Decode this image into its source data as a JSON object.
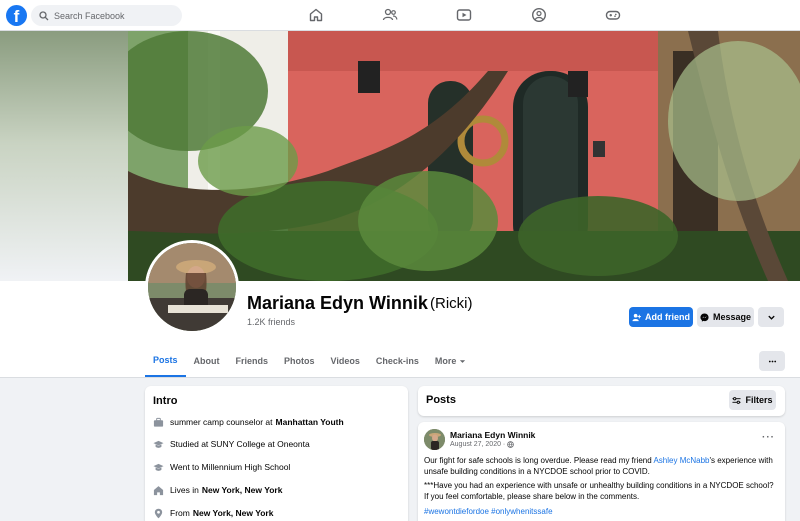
{
  "topbar": {
    "logo": "f",
    "search_placeholder": "Search Facebook",
    "nav_icons": [
      "home-icon",
      "friends-icon",
      "watch-icon",
      "groups-icon",
      "gaming-icon"
    ]
  },
  "profile": {
    "name": "Mariana Edyn Winnik",
    "nickname": "(Ricki)",
    "friends_count": "1.2K friends",
    "add_friend_label": "Add friend",
    "message_label": "Message"
  },
  "tabs": [
    {
      "label": "Posts",
      "active": true
    },
    {
      "label": "About"
    },
    {
      "label": "Friends"
    },
    {
      "label": "Photos"
    },
    {
      "label": "Videos"
    },
    {
      "label": "Check-ins"
    },
    {
      "label": "More"
    }
  ],
  "intro": {
    "title": "Intro",
    "items": [
      {
        "text": "summer camp counselor at",
        "bold": "Manhattan Youth",
        "icon": "briefcase-icon"
      },
      {
        "text": "Studied at SUNY College at Oneonta",
        "bold": "",
        "icon": "graduation-cap-icon"
      },
      {
        "text": "Went to Millennium High School",
        "bold": "",
        "icon": "graduation-cap-icon"
      },
      {
        "text": "Lives in",
        "bold": "New York, New York",
        "icon": "home-icon"
      },
      {
        "text": "From",
        "bold": "New York, New York",
        "icon": "location-pin-icon"
      }
    ]
  },
  "posts": {
    "title": "Posts",
    "filters_label": "Filters",
    "post": {
      "author": "Mariana Edyn Winnik",
      "date": "August 27, 2020 ·",
      "para1_a": "Our fight for safe schools is long overdue. Please read my friend ",
      "para1_link": "Ashley McNabb",
      "para1_b": "'s experience with unsafe building conditions in a NYCDOE school prior to COVID.",
      "para2": "***Have you had an experience with unsafe or unhealthy building conditions in a NYCDOE school? If you feel comfortable, please share below in the comments.",
      "hashtags": "#wewontdiefordoe #onlywhenitssafe"
    }
  },
  "colors": {
    "accent": "#1b74e4",
    "background": "#f0f2f5",
    "secondary_text": "#65676b"
  }
}
